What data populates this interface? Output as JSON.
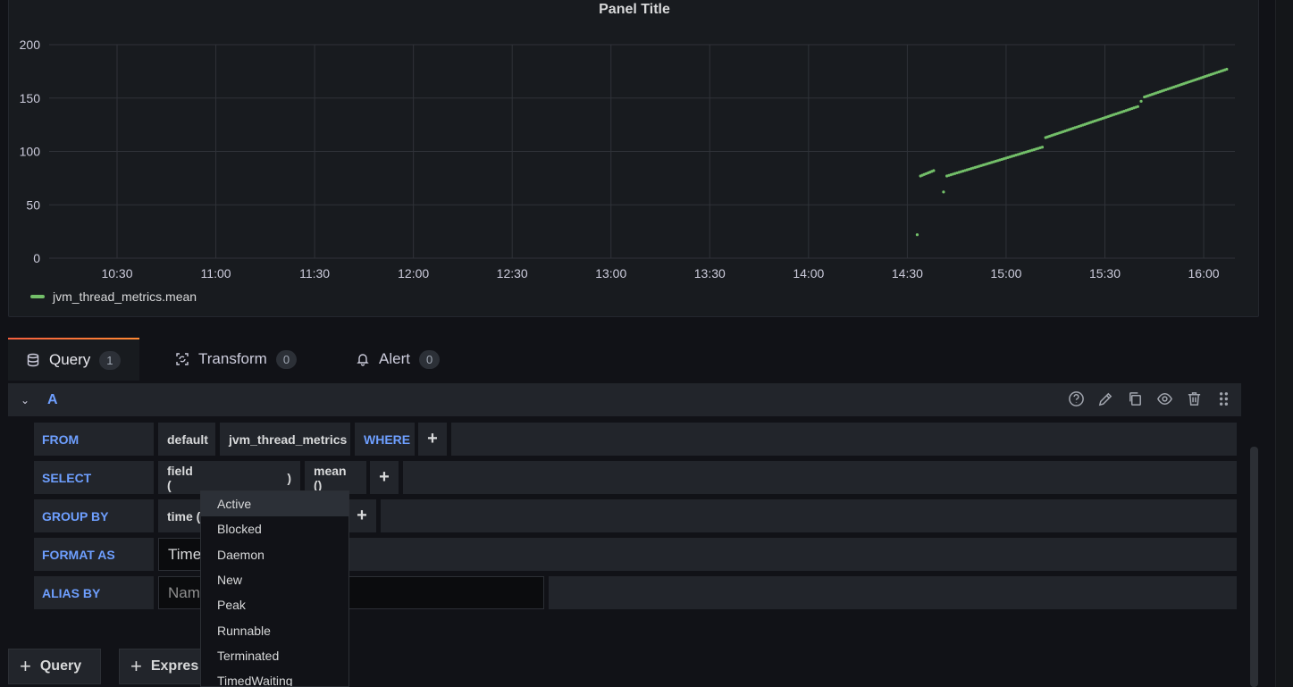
{
  "panel": {
    "title": "Panel Title"
  },
  "chart_data": {
    "type": "scatter",
    "title": "Panel Title",
    "ylim": [
      0,
      200
    ],
    "yticks": [
      "0",
      "50",
      "100",
      "150",
      "200"
    ],
    "xticks": [
      "10:30",
      "11:00",
      "11:30",
      "12:00",
      "12:30",
      "13:00",
      "13:30",
      "14:00",
      "14:30",
      "15:00",
      "15:30",
      "16:00"
    ],
    "legend": "bottom-left",
    "grid": true,
    "series": [
      {
        "name": "jvm_thread_metrics.mean",
        "color": "#73bf69",
        "segments": [
          {
            "from": "14:33",
            "to": "14:33",
            "y_from": 22,
            "y_to": 22,
            "points": 1
          },
          {
            "from": "14:34",
            "to": "14:38",
            "y_from": 77,
            "y_to": 82,
            "points": 8
          },
          {
            "from": "14:41",
            "to": "14:41",
            "y_from": 62,
            "y_to": 62,
            "points": 1
          },
          {
            "from": "14:42",
            "to": "15:11",
            "y_from": 77,
            "y_to": 104,
            "points": 48
          },
          {
            "from": "15:12",
            "to": "15:40",
            "y_from": 113,
            "y_to": 142,
            "points": 48
          },
          {
            "from": "15:41",
            "to": "15:41",
            "y_from": 147,
            "y_to": 147,
            "points": 1
          },
          {
            "from": "15:42",
            "to": "16:07",
            "y_from": 151,
            "y_to": 177,
            "points": 43
          }
        ]
      }
    ]
  },
  "tabs": [
    {
      "label": "Query",
      "count": "1",
      "icon": "database-icon"
    },
    {
      "label": "Transform",
      "count": "0",
      "icon": "transform-icon"
    },
    {
      "label": "Alert",
      "count": "0",
      "icon": "bell-icon"
    }
  ],
  "query": {
    "letter": "A",
    "header_icons": [
      "help-icon",
      "pencil-icon",
      "copy-icon",
      "eye-icon",
      "trash-icon",
      "drag-icon"
    ],
    "from": {
      "label": "FROM",
      "policy": "default",
      "measurement": "jvm_thread_metrics",
      "where": "WHERE"
    },
    "select": {
      "label": "SELECT",
      "field_prefix": "field (",
      "field_suffix": ")",
      "fn": "mean ()"
    },
    "group_by": {
      "label": "GROUP BY",
      "time": "time ("
    },
    "format_as": {
      "label": "FORMAT AS",
      "value": "Time"
    },
    "alias_by": {
      "label": "ALIAS BY",
      "placeholder": "Nam"
    }
  },
  "dropdown": {
    "items": [
      "Active",
      "Blocked",
      "Daemon",
      "New",
      "Peak",
      "Runnable",
      "Terminated",
      "TimedWaiting"
    ],
    "highlighted": "Active"
  },
  "buttons": {
    "add_query": "Query",
    "add_expression": "Expres"
  }
}
